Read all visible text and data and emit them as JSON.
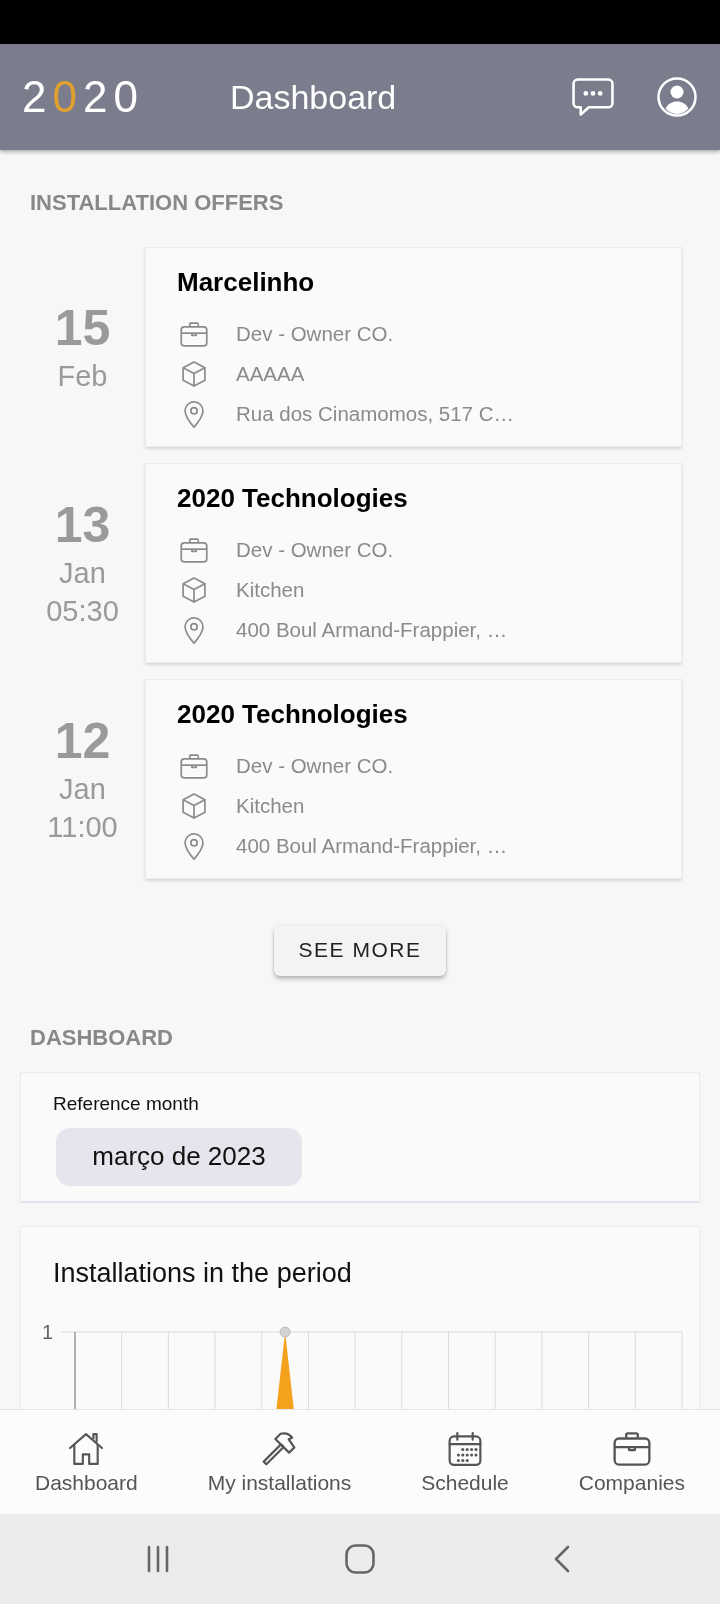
{
  "app_bar": {
    "logo": "2020",
    "title": "Dashboard"
  },
  "installation_offers": {
    "heading": "INSTALLATION OFFERS",
    "items": [
      {
        "day": "15",
        "month": "Feb",
        "client": "Marcelinho",
        "details": [
          {
            "kind": "company",
            "text": "Dev - Owner CO."
          },
          {
            "kind": "project",
            "text": "AAAAA"
          },
          {
            "kind": "address",
            "text": "Rua dos Cinamomos, 517 C…"
          }
        ]
      },
      {
        "day": "13",
        "month": "Jan",
        "time": "05:30",
        "client": "2020 Technologies",
        "details": [
          {
            "kind": "company",
            "text": "Dev - Owner CO."
          },
          {
            "kind": "project",
            "text": "Kitchen"
          },
          {
            "kind": "address",
            "text": "400 Boul Armand-Frappier, …"
          }
        ]
      },
      {
        "day": "12",
        "month": "Jan",
        "time": "11:00",
        "client": "2020 Technologies",
        "details": [
          {
            "kind": "company",
            "text": "Dev - Owner CO."
          },
          {
            "kind": "project",
            "text": "Kitchen"
          },
          {
            "kind": "address",
            "text": "400 Boul Armand-Frappier, …"
          }
        ]
      }
    ],
    "see_more": "SEE MORE"
  },
  "dashboard": {
    "heading": "DASHBOARD",
    "reference_month": {
      "label": "Reference month",
      "value": "março de 2023"
    },
    "chart": {
      "title": "Installations in the period",
      "y_axis_label": "1"
    }
  },
  "bottom_nav": [
    {
      "label": "Dashboard",
      "selected": false
    },
    {
      "label": "My installations",
      "selected": false
    },
    {
      "label": "Schedule",
      "selected": false
    },
    {
      "label": "Companies",
      "selected": false
    }
  ]
}
